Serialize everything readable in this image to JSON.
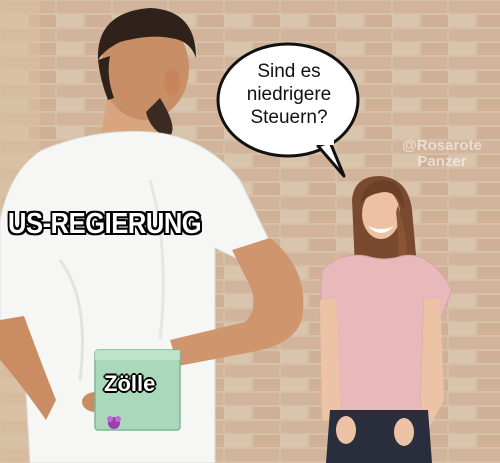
{
  "speech_bubble": {
    "lines": [
      "Sind es",
      "niedrigere",
      "Steuern?"
    ]
  },
  "labels": {
    "man": "US-REGIERUNG",
    "gift": "Zölle"
  },
  "watermark": {
    "lines": [
      "@Rosarote",
      "Panzer"
    ]
  },
  "colors": {
    "wall": "#c9a98a",
    "gift_box": "#a8d8b8",
    "man_shirt": "#f4f4f4",
    "woman_shirt": "#e8b4b8"
  }
}
